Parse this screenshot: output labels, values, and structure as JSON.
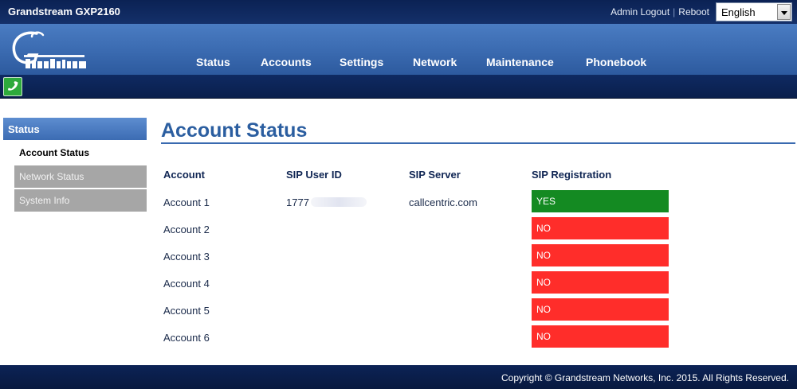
{
  "app": {
    "product": "Grandstream GXP2160",
    "admin_logout": "Admin Logout",
    "separator": "|",
    "reboot": "Reboot",
    "language": "English"
  },
  "logo": {
    "alt": "Grandstream"
  },
  "nav": {
    "items": [
      {
        "label": "Status"
      },
      {
        "label": "Accounts"
      },
      {
        "label": "Settings"
      },
      {
        "label": "Network"
      },
      {
        "label": "Maintenance"
      },
      {
        "label": "Phonebook"
      }
    ]
  },
  "sidebar": {
    "header": "Status",
    "items": [
      {
        "label": "Account Status"
      },
      {
        "label": "Network Status"
      },
      {
        "label": "System Info"
      }
    ]
  },
  "main": {
    "title": "Account Status",
    "columns": [
      "Account",
      "SIP User ID",
      "SIP Server",
      "SIP Registration"
    ],
    "rows": [
      {
        "account": "Account 1",
        "user_id": "1777",
        "server": "callcentric.com",
        "registration": "YES"
      },
      {
        "account": "Account 2",
        "user_id": "",
        "server": "",
        "registration": "NO"
      },
      {
        "account": "Account 3",
        "user_id": "",
        "server": "",
        "registration": "NO"
      },
      {
        "account": "Account 4",
        "user_id": "",
        "server": "",
        "registration": "NO"
      },
      {
        "account": "Account 5",
        "user_id": "",
        "server": "",
        "registration": "NO"
      },
      {
        "account": "Account 6",
        "user_id": "",
        "server": "",
        "registration": "NO"
      }
    ]
  },
  "colors": {
    "registered": "#148a22",
    "unregistered": "#ff2d2a",
    "accent": "#3a6ab0"
  },
  "footer": {
    "copyright": "Copyright © Grandstream Networks, Inc. 2015. All Rights Reserved."
  }
}
